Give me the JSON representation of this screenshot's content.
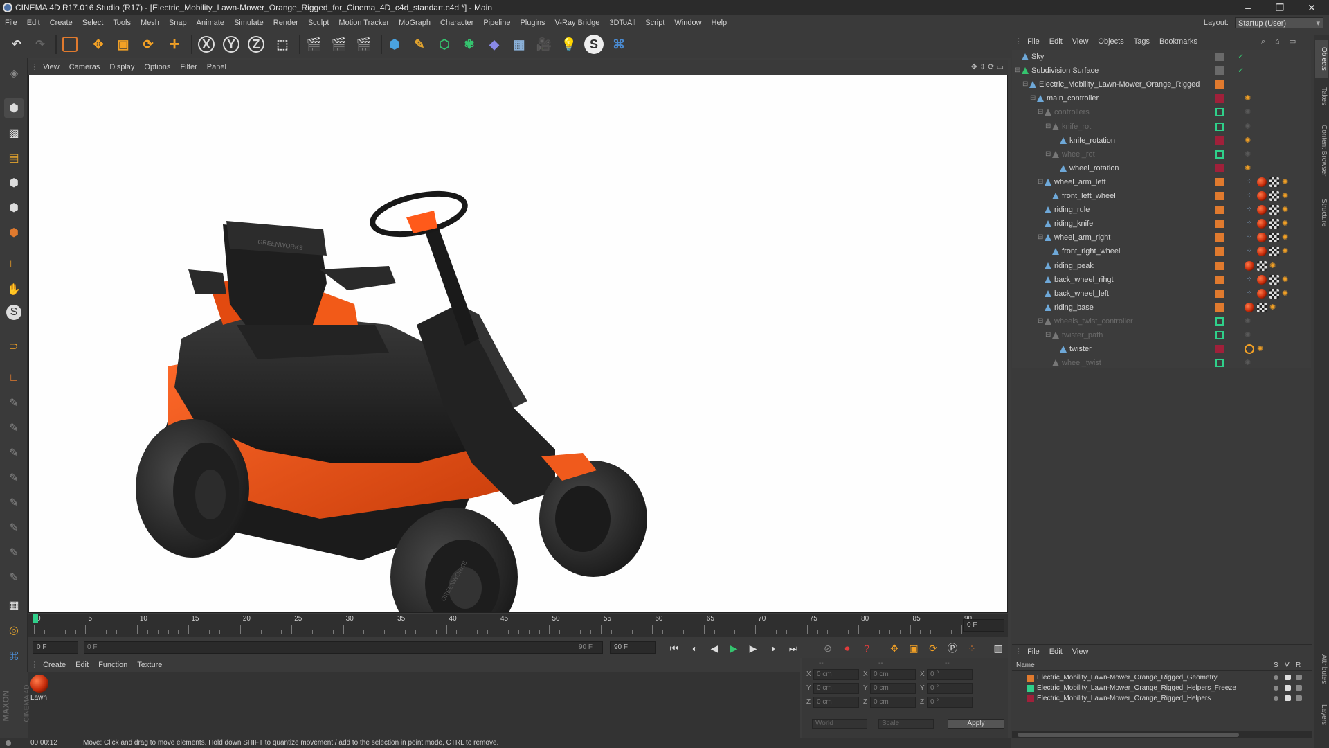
{
  "window": {
    "title": "CINEMA 4D R17.016 Studio (R17) - [Electric_Mobility_Lawn-Mower_Orange_Rigged_for_Cinema_4D_c4d_standart.c4d *] - Main",
    "controls": [
      "–",
      "❐",
      "✕"
    ]
  },
  "menubar": {
    "items": [
      "File",
      "Edit",
      "Create",
      "Select",
      "Tools",
      "Mesh",
      "Snap",
      "Animate",
      "Simulate",
      "Render",
      "Sculpt",
      "Motion Tracker",
      "MoGraph",
      "Character",
      "Pipeline",
      "Plugins",
      "V-Ray Bridge",
      "3DToAll",
      "Script",
      "Window",
      "Help"
    ],
    "layout_label": "Layout:",
    "layout_value": "Startup (User)"
  },
  "toolbar": {
    "icons": [
      "undo-icon",
      "redo-icon",
      "live-selection-icon",
      "move-icon",
      "scale-icon",
      "rotate-icon",
      "last-tool-icon",
      "x-axis-icon",
      "y-axis-icon",
      "z-axis-icon",
      "coordinate-system-icon",
      "render-view-icon",
      "render-picture-viewer-icon",
      "edit-render-settings-icon",
      "cube-icon",
      "pen-icon",
      "subdivision-icon",
      "array-icon",
      "deformer-icon",
      "floor-icon",
      "camera-icon",
      "light-icon",
      "vray-icon",
      "python-icon"
    ],
    "axis_labels": [
      "X",
      "Y",
      "Z"
    ]
  },
  "viewport": {
    "menu": [
      "View",
      "Cameras",
      "Display",
      "Options",
      "Filter",
      "Panel"
    ],
    "seat_brand": "GREENWORKS",
    "tire_text": "GREENWORKS"
  },
  "timeline": {
    "ticks": [
      "0",
      "5",
      "10",
      "15",
      "20",
      "25",
      "30",
      "35",
      "40",
      "45",
      "50",
      "55",
      "60",
      "65",
      "70",
      "75",
      "80",
      "85",
      "90"
    ],
    "current_frame": "0 F"
  },
  "playbar": {
    "start_field": "0 F",
    "range_start": "0 F",
    "range_end": "90 F",
    "end_field": "90 F"
  },
  "material_manager": {
    "menu": [
      "Create",
      "Edit",
      "Function",
      "Texture"
    ],
    "material_name": "Lawn"
  },
  "coordinates": {
    "header": [
      "--",
      "--",
      "--"
    ],
    "rows": [
      {
        "a": "X",
        "v1": "0 cm",
        "b": "X",
        "v2": "0 cm",
        "c": "X",
        "v3": "0 °"
      },
      {
        "a": "Y",
        "v1": "0 cm",
        "b": "Y",
        "v2": "0 cm",
        "c": "Y",
        "v3": "0 °"
      },
      {
        "a": "Z",
        "v1": "0 cm",
        "b": "Z",
        "v2": "0 cm",
        "c": "Z",
        "v3": "0 °"
      }
    ],
    "world": "World",
    "scale": "Scale",
    "apply": "Apply"
  },
  "status": {
    "time": "00:00:12",
    "message": "Move: Click and drag to move elements. Hold down SHIFT to quantize movement / add to the selection in point mode, CTRL to remove."
  },
  "maxon": {
    "line1": "MAXON",
    "line2": "CINEMA 4D"
  },
  "object_manager": {
    "menu": [
      "File",
      "Edit",
      "View",
      "Objects",
      "Tags",
      "Bookmarks"
    ],
    "objects": [
      {
        "name": "Sky",
        "indent": 0,
        "expander": "",
        "icon": "#6ea8d8",
        "dim": false,
        "color": "#6a6a6a",
        "check": "✓",
        "tags": []
      },
      {
        "name": "Subdivision Surface",
        "indent": 0,
        "expander": "⊟",
        "icon": "#35c46f",
        "dim": false,
        "color": "#6a6a6a",
        "check": "✓",
        "tags": []
      },
      {
        "name": "Electric_Mobility_Lawn-Mower_Orange_Rigged",
        "indent": 1,
        "expander": "⊟",
        "icon": "#6ea8d8",
        "dim": false,
        "color": "#e07a2e",
        "check": "",
        "tags": []
      },
      {
        "name": "main_controller",
        "indent": 2,
        "expander": "⊟",
        "icon": "#6ea8d8",
        "dim": false,
        "color": "#a0203a",
        "check": "",
        "tags": [
          "ik"
        ]
      },
      {
        "name": "controllers",
        "indent": 3,
        "expander": "⊟",
        "icon": "#777",
        "dim": true,
        "color": "#2fd08a",
        "check": "",
        "tags": [
          "dim"
        ]
      },
      {
        "name": "knife_rot",
        "indent": 4,
        "expander": "⊟",
        "icon": "#777",
        "dim": true,
        "color": "#2fd08a",
        "check": "",
        "tags": [
          "dim"
        ]
      },
      {
        "name": "knife_rotation",
        "indent": 5,
        "expander": "",
        "icon": "#6ea8d8",
        "dim": false,
        "color": "#a0203a",
        "check": "",
        "tags": [
          "ik"
        ]
      },
      {
        "name": "wheel_rot",
        "indent": 4,
        "expander": "⊟",
        "icon": "#777",
        "dim": true,
        "color": "#2fd08a",
        "check": "",
        "tags": [
          "dim"
        ]
      },
      {
        "name": "wheel_rotation",
        "indent": 5,
        "expander": "",
        "icon": "#6ea8d8",
        "dim": false,
        "color": "#a0203a",
        "check": "",
        "tags": [
          "ik"
        ]
      },
      {
        "name": "wheel_arm_left",
        "indent": 3,
        "expander": "⊟",
        "icon": "#6ea8d8",
        "dim": false,
        "color": "#e07a2e",
        "check": "",
        "tags": [
          "dots",
          "mat",
          "checker",
          "ik"
        ]
      },
      {
        "name": "front_left_wheel",
        "indent": 4,
        "expander": "",
        "icon": "#6ea8d8",
        "dim": false,
        "color": "#e07a2e",
        "check": "",
        "tags": [
          "dots",
          "mat",
          "checker",
          "ik"
        ]
      },
      {
        "name": "riding_rule",
        "indent": 3,
        "expander": "",
        "icon": "#6ea8d8",
        "dim": false,
        "color": "#e07a2e",
        "check": "",
        "tags": [
          "dots",
          "mat",
          "checker",
          "ik"
        ]
      },
      {
        "name": "riding_knife",
        "indent": 3,
        "expander": "",
        "icon": "#6ea8d8",
        "dim": false,
        "color": "#e07a2e",
        "check": "",
        "tags": [
          "dots",
          "mat",
          "checker",
          "ik"
        ]
      },
      {
        "name": "wheel_arm_right",
        "indent": 3,
        "expander": "⊟",
        "icon": "#6ea8d8",
        "dim": false,
        "color": "#e07a2e",
        "check": "",
        "tags": [
          "dots",
          "mat",
          "checker",
          "ik"
        ]
      },
      {
        "name": "front_right_wheel",
        "indent": 4,
        "expander": "",
        "icon": "#6ea8d8",
        "dim": false,
        "color": "#e07a2e",
        "check": "",
        "tags": [
          "dots",
          "mat",
          "checker",
          "ik"
        ]
      },
      {
        "name": "riding_peak",
        "indent": 3,
        "expander": "",
        "icon": "#6ea8d8",
        "dim": false,
        "color": "#e07a2e",
        "check": "",
        "tags": [
          "mat",
          "checker",
          "ik"
        ]
      },
      {
        "name": "back_wheel_rihgt",
        "indent": 3,
        "expander": "",
        "icon": "#6ea8d8",
        "dim": false,
        "color": "#e07a2e",
        "check": "",
        "tags": [
          "dots",
          "mat",
          "checker",
          "ik"
        ]
      },
      {
        "name": "back_wheel_left",
        "indent": 3,
        "expander": "",
        "icon": "#6ea8d8",
        "dim": false,
        "color": "#e07a2e",
        "check": "",
        "tags": [
          "dots",
          "mat",
          "checker",
          "ik"
        ]
      },
      {
        "name": "riding_base",
        "indent": 3,
        "expander": "",
        "icon": "#6ea8d8",
        "dim": false,
        "color": "#e07a2e",
        "check": "",
        "tags": [
          "mat",
          "checker",
          "ik"
        ]
      },
      {
        "name": "wheels_twist_controller",
        "indent": 3,
        "expander": "⊟",
        "icon": "#777",
        "dim": true,
        "color": "#2fd08a",
        "check": "",
        "tags": [
          "dim"
        ]
      },
      {
        "name": "twister_path",
        "indent": 4,
        "expander": "⊟",
        "icon": "#777",
        "dim": true,
        "color": "#2fd08a",
        "check": "",
        "tags": [
          "dim"
        ]
      },
      {
        "name": "twister",
        "indent": 5,
        "expander": "",
        "icon": "#6ea8d8",
        "dim": false,
        "color": "#a0203a",
        "check": "",
        "tags": [
          "forbid",
          "ik"
        ]
      },
      {
        "name": "wheel_twist",
        "indent": 4,
        "expander": "",
        "icon": "#777",
        "dim": true,
        "color": "#2fd08a",
        "check": "",
        "tags": [
          "dim"
        ]
      }
    ]
  },
  "side_tabs": [
    "Objects",
    "Takes",
    "Content Browser",
    "Structure"
  ],
  "side_tabs_lower": [
    "Attributes",
    "Layers"
  ],
  "layer_manager": {
    "menu": [
      "File",
      "Edit",
      "View"
    ],
    "header": {
      "name": "Name",
      "s": "S",
      "v": "V",
      "r": "R"
    },
    "layers": [
      {
        "name": "Electric_Mobility_Lawn-Mower_Orange_Rigged_Geometry",
        "color": "#e07a2e"
      },
      {
        "name": "Electric_Mobility_Lawn-Mower_Orange_Rigged_Helpers_Freeze",
        "color": "#2fd08a"
      },
      {
        "name": "Electric_Mobility_Lawn-Mower_Orange_Rigged_Helpers",
        "color": "#a0203a"
      }
    ]
  }
}
